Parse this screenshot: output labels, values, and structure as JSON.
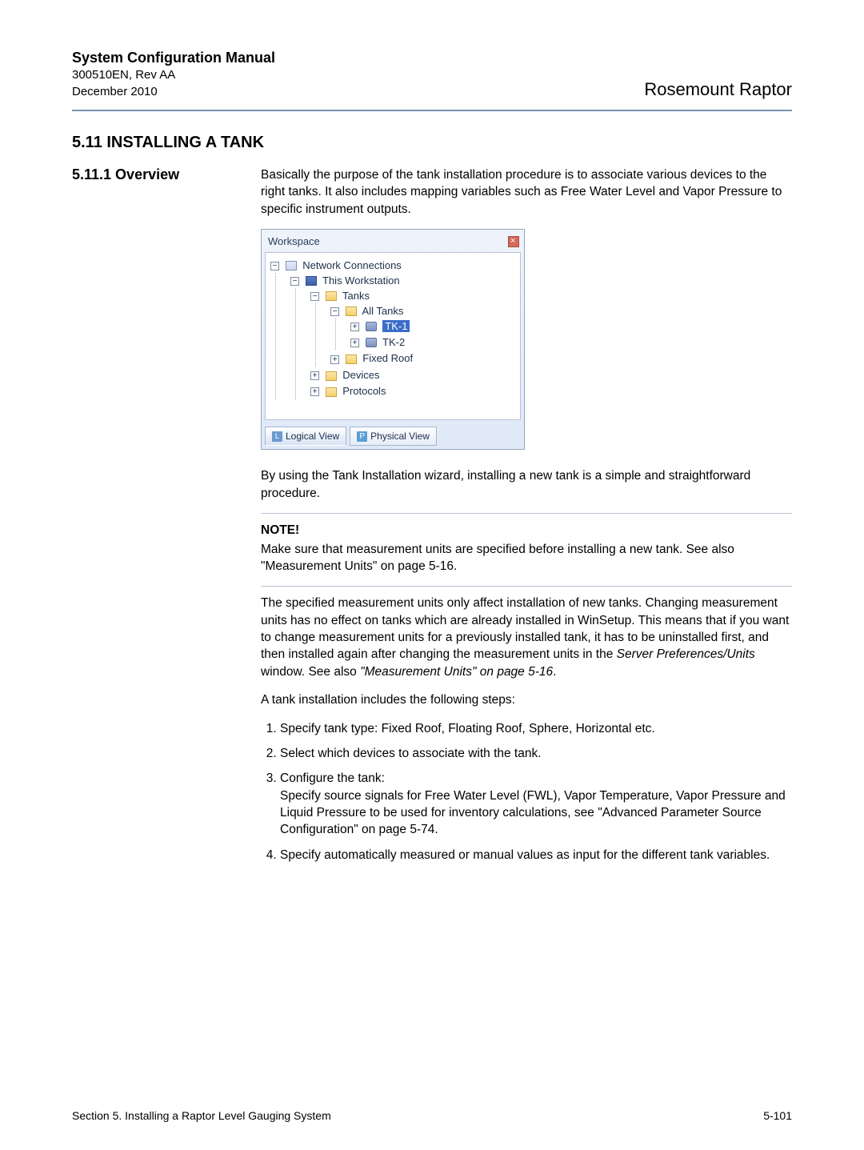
{
  "header": {
    "title": "System Configuration Manual",
    "ref": "300510EN, Rev AA",
    "date": "December 2010",
    "right": "Rosemount Raptor"
  },
  "section": {
    "num_title": "5.11 INSTALLING A TANK",
    "sub_label": "5.11.1  Overview"
  },
  "content": {
    "intro": "Basically the purpose of the tank installation procedure is to associate various devices to the right tanks. It also includes mapping variables such as Free Water Level and Vapor Pressure to specific instrument outputs.",
    "after_image": "By using the Tank Installation wizard, installing a new tank is a simple and straightforward procedure.",
    "note_title": "NOTE!",
    "note_body": "Make sure that measurement units are specified before installing a new tank. See also \"Measurement Units\" on page 5-16.",
    "para2a": "The specified measurement units only affect installation of new tanks. Changing measurement units has no effect on tanks which are already installed in WinSetup. This means that if you want to change measurement units for a previously installed tank, it has to be uninstalled first, and then installed again after changing the measurement units in the ",
    "para2b_italic": "Server Preferences/Units",
    "para2c": " window. See also ",
    "para2d_italic": "\"Measurement Units\" on page 5-16",
    "para2e": ".",
    "steps_intro": "A tank installation includes the following steps:",
    "steps": [
      "Specify tank type: Fixed Roof, Floating Roof, Sphere, Horizontal etc.",
      "Select which devices to associate with the tank.",
      "Configure the tank:\nSpecify source signals for Free Water Level (FWL), Vapor Temperature, Vapor Pressure and Liquid Pressure to be used for inventory calculations, see \"Advanced Parameter Source Configuration\" on page 5-74.",
      "Specify automatically measured or manual values as input for the different tank variables."
    ]
  },
  "workspace": {
    "title": "Workspace",
    "tabs": {
      "logical": "Logical View",
      "physical": "Physical View",
      "l_badge": "L",
      "p_badge": "P"
    },
    "tree": {
      "root": "Network Connections",
      "ws": "This Workstation",
      "tanks": "Tanks",
      "all_tanks": "All Tanks",
      "tk1": "TK-1",
      "tk2": "TK-2",
      "fixed_roof": "Fixed Roof",
      "devices": "Devices",
      "protocols": "Protocols"
    },
    "exp_minus": "−",
    "exp_plus": "+"
  },
  "footer": {
    "left": "Section 5. Installing a Raptor Level Gauging System",
    "right": "5-101"
  }
}
